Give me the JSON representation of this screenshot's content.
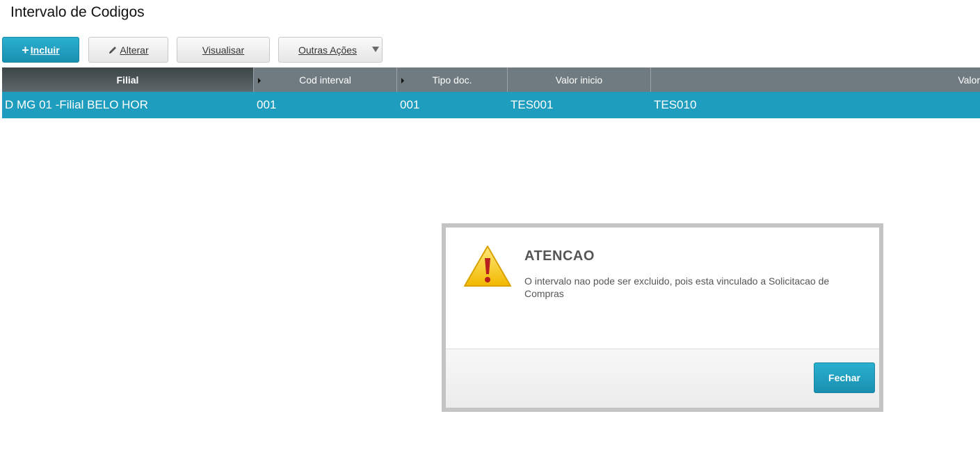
{
  "page": {
    "title": "Intervalo de Codigos"
  },
  "toolbar": {
    "include_label": "Incluir",
    "alter_label": "Alterar",
    "view_label": "Visualisar",
    "other_actions_label": "Outras Ações",
    "icons": {
      "include": "plus-icon",
      "alter": "pencil-icon",
      "other_actions": "caret-down-icon"
    }
  },
  "grid": {
    "columns": [
      "Filial",
      "Cod interval",
      "Tipo doc.",
      "Valor inicio",
      "Valor"
    ],
    "rows": [
      [
        "D MG 01 -Filial BELO HOR",
        "001",
        "001",
        "TES001",
        "TES010"
      ]
    ],
    "selected_row": 0
  },
  "dialog": {
    "title": "ATENCAO",
    "message": "O intervalo nao pode ser excluido, pois esta vinculado a Solicitacao de Compras",
    "close_label": "Fechar",
    "icon": "warning-icon"
  },
  "colors": {
    "accent": "#1f9dbf",
    "header_bg": "#6f7b80",
    "warning": "#f5c400"
  }
}
